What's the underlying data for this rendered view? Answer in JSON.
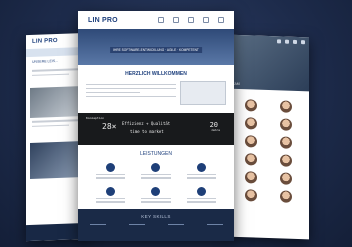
{
  "brand": {
    "logo": "LIN PRO",
    "logo_left": "LIN PRO"
  },
  "left_page": {
    "heading": "UNSERE LEIS..."
  },
  "right_page": {
    "heading": "TEAM"
  },
  "center_page": {
    "hero_bar": "IHRE SOFTWARE-ENTWICKLUNG · AGILE · KOMPETENT",
    "welcome": "HERZLICH WILLKOMMEN",
    "chalk": {
      "big": "28×",
      "formula1": "Effizienz + Qualität",
      "formula2": "time to market",
      "right_big": "20",
      "right_small": "Jahre",
      "top_left": "Konzeption"
    },
    "services_title": "LEISTUNGEN",
    "key_skills": "KEY SKILLS"
  },
  "colors": {
    "brand_blue": "#1d3f7c",
    "backdrop": "#1c2a4a",
    "footer": "#1a2a47"
  }
}
